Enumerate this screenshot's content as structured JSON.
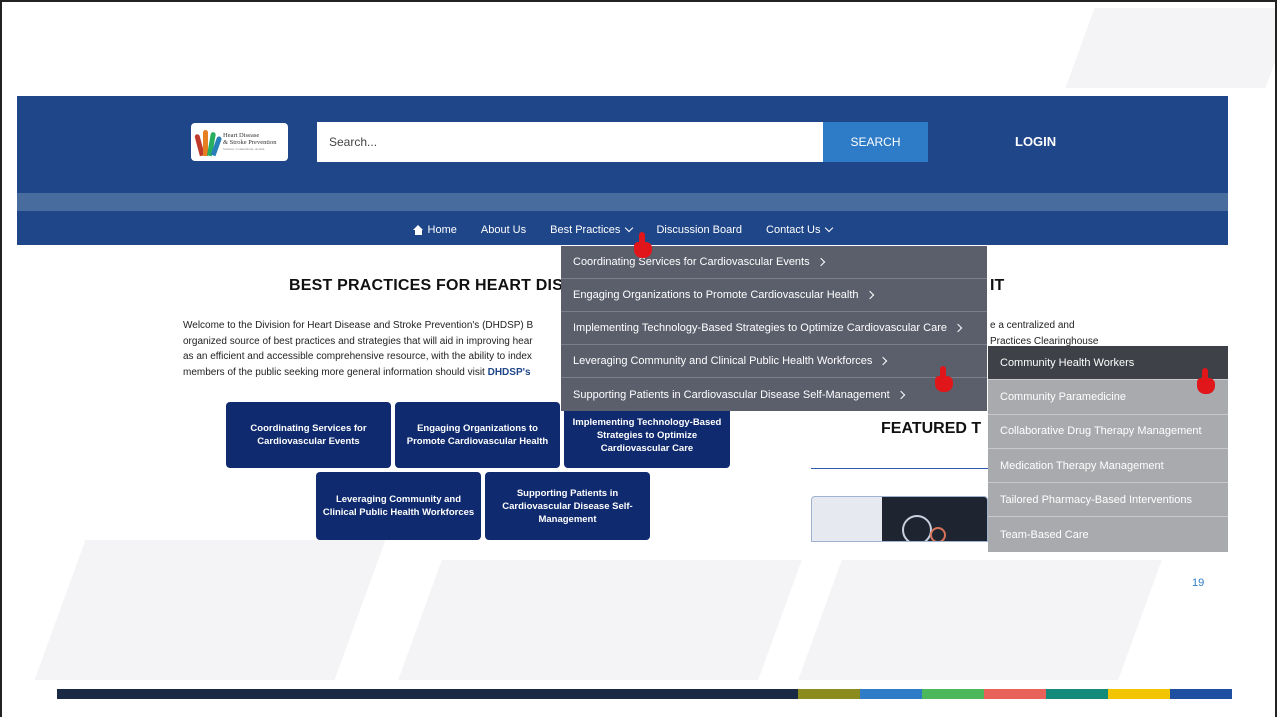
{
  "header": {
    "logo_text_line1": "Heart Disease",
    "logo_text_line2": "& Stroke Prevention",
    "logo_tagline": "Science. Connections. Action.",
    "search_placeholder": "Search...",
    "search_button": "SEARCH",
    "login": "LOGIN",
    "colors": {
      "primary": "#1f4688",
      "accent": "#2e7cc7",
      "stripe": "#486c9e"
    }
  },
  "nav": {
    "items": [
      {
        "label": "Home",
        "icon": "home-icon"
      },
      {
        "label": "About Us"
      },
      {
        "label": "Best Practices",
        "has_dropdown": true
      },
      {
        "label": "Discussion Board"
      },
      {
        "label": "Contact Us",
        "has_dropdown": true
      }
    ]
  },
  "dropdown": {
    "items": [
      "Coordinating Services for Cardiovascular Events",
      "Engaging Organizations to Promote Cardiovascular Health",
      "Implementing Technology-Based Strategies to Optimize Cardiovascular Care",
      "Leveraging Community and Clinical Public Health Workforces",
      "Supporting Patients in Cardiovascular Disease Self-Management"
    ]
  },
  "submenu": {
    "items": [
      "Community Health Workers",
      "Community Paramedicine",
      "Collaborative Drug Therapy Management",
      "Medication Therapy Management",
      "Tailored Pharmacy-Based Interventions",
      "Team-Based Care"
    ]
  },
  "main": {
    "title_visible": "BEST PRACTICES FOR HEART DIS",
    "title_tail": "IT",
    "intro_lines": [
      "Welcome to the Division for Heart Disease and Stroke Prevention's (DHDSP) B",
      "organized source of best practices and strategies that will aid in improving hear",
      "as an efficient and accessible comprehensive resource, with the ability to index",
      "members of the public seeking more general information should visit "
    ],
    "intro_link": "DHDSP's",
    "intro_right_lines": [
      "e a centralized and",
      "Practices Clearinghouse"
    ],
    "tiles_row1": [
      "Coordinating Services for Cardiovascular Events",
      "Engaging Organizations to Promote Cardiovascular Health",
      "Implementing Technology-Based Strategies to Optimize Cardiovascular Care"
    ],
    "tiles_row2": [
      "Leveraging Community and Clinical Public Health Workforces",
      "Supporting Patients in Cardiovascular Disease Self-Management"
    ],
    "featured_title": "FEATURED T"
  },
  "slide": {
    "page_number": "19",
    "bottom_bar_colors": [
      "#1b2a44",
      "#8c8c1e",
      "#2e7cc7",
      "#4cb85c",
      "#e8625a",
      "#138a7a",
      "#f2c500",
      "#1f4fa0"
    ]
  }
}
